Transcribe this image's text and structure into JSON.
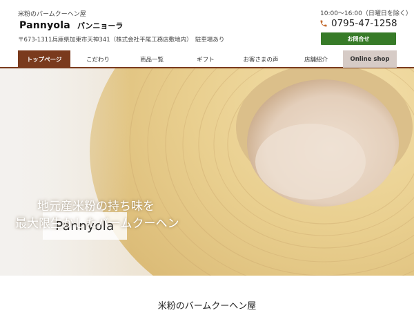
{
  "header": {
    "tagline": "米粉のバームクーヘン屋",
    "logo_text": "Pannyola",
    "logo_kana": "パンニョーラ",
    "address": "〒673-1311兵庫県加東市天神341（株式会社平尾工務店敷地内）　駐車場あり",
    "hours": "10:00〜16:00（日曜日を除く）",
    "phone": "0795-47-1258",
    "contact_label": "お問合せ"
  },
  "nav": {
    "items": [
      {
        "label": "トップページ"
      },
      {
        "label": "こだわり"
      },
      {
        "label": "商品一覧"
      },
      {
        "label": "ギフト"
      },
      {
        "label": "お客さまの声"
      },
      {
        "label": "店舗紹介"
      },
      {
        "label": "Online shop"
      }
    ],
    "active_index": 0
  },
  "hero": {
    "logo_text": "Pannyola",
    "copy_line1": "地元産米粉の持ち味を",
    "copy_line2": "最大限生かしたバームクーヘン"
  },
  "main": {
    "section_title": "米粉のバームクーヘン屋"
  },
  "colors": {
    "brand_brown": "#7a3a1d",
    "contact_green": "#377b28",
    "shop_bg": "#d6cbc6",
    "phone_icon": "#c36b2f"
  },
  "icons": {
    "phone": "phone-icon"
  }
}
